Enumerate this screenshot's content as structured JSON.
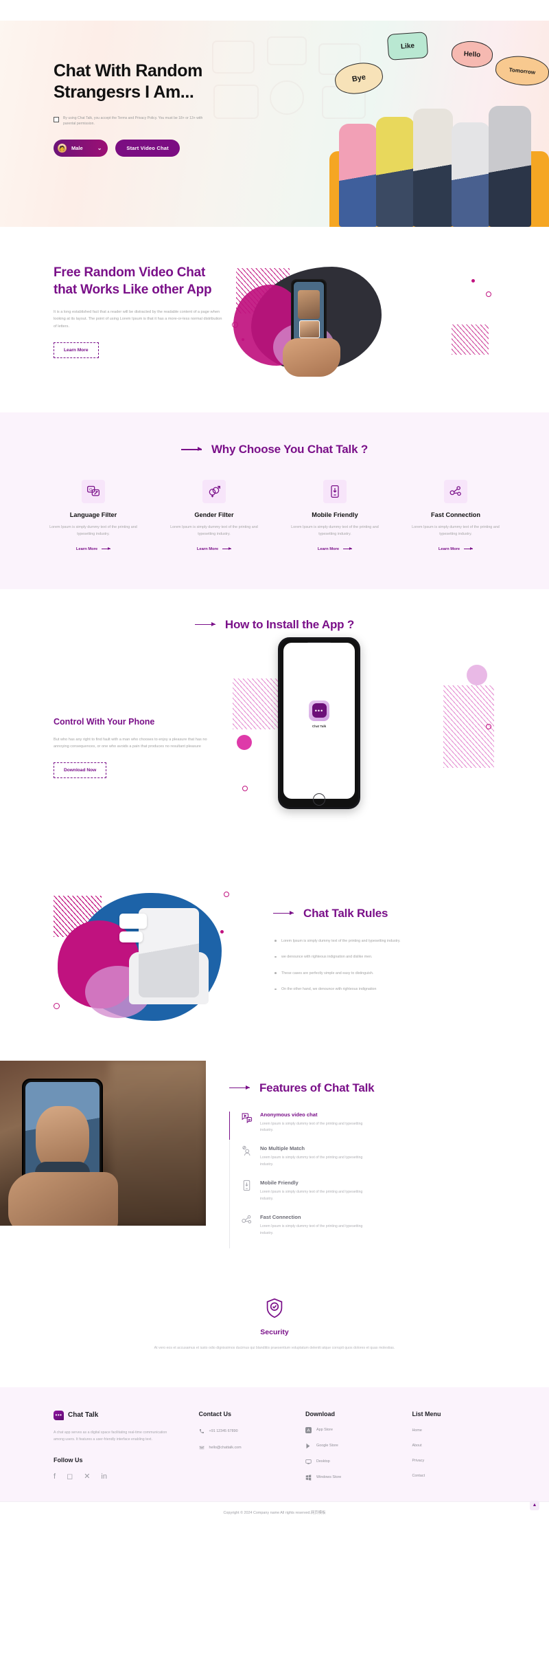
{
  "hero": {
    "title": "Chat With Random Strangesrs I Am...",
    "consent": "By using Chat Talk, you accept the Terms and Privacy Policy. You must be 18+ or 13+ with parental permission.",
    "gender_button": "Male",
    "start_button": "Start Video Chat",
    "bubbles": {
      "bye": "Bye",
      "like": "Like",
      "hello": "Hello",
      "tomorrow": "Tomorrow"
    }
  },
  "free_section": {
    "title": "Free Random Video Chat that Works Like other App",
    "body": "It is a long established fact that a reader will be distracted by the readable content of a page when looking at its layout. The point of using Lorem Ipsum is that it has a more-or-less normal distribution of letters.",
    "button": "Learn More"
  },
  "why": {
    "title": "Why Choose You Chat Talk ?",
    "cards": [
      {
        "name": "Language Filter",
        "desc": "Lorem Ipsum is simply dummy text of the printing and typesetting industry.",
        "link": "Learn More",
        "icon": "translate-icon"
      },
      {
        "name": "Gender Filter",
        "desc": "Lorem Ipsum is simply dummy text of the printing and typesetting industry.",
        "link": "Learn More",
        "icon": "gender-icon"
      },
      {
        "name": "Mobile Friendly",
        "desc": "Lorem Ipsum is simply dummy text of the printing and typesetting industry.",
        "link": "Learn More",
        "icon": "mobile-icon"
      },
      {
        "name": "Fast Connection",
        "desc": "Lorem Ipsum is simply dummy text of the printing and typesetting industry.",
        "link": "Learn More",
        "icon": "network-icon"
      }
    ]
  },
  "install": {
    "title": "How to Install the App ?",
    "heading": "Control With Your Phone",
    "body": "But who has any right to find fault with a man who chooses to enjoy a pleasure that has no annoying consequences, or one who avoids a pain that produces no resultant pleasure",
    "button": "Download Now",
    "app_label": "Chat Talk"
  },
  "rules": {
    "title": "Chat Talk Rules",
    "items": [
      "Lorem Ipsum is simply dummy text of the printing and typesetting industry.",
      "we denounce with righteous indignation and dislike men.",
      "These cases are perfectly simple and easy to distinguish.",
      "On the other hand, we denounce with righteous indignation"
    ]
  },
  "features": {
    "title": "Features of Chat Talk",
    "items": [
      {
        "name": "Anonymous video chat",
        "desc": "Lorem Ipsum is simply dummy text of the printing and typesetting industry.",
        "icon": "video-chat-icon",
        "active": true
      },
      {
        "name": "No Multiple Match",
        "desc": "Lorem Ipsum is simply dummy text of the printing and typesetting industry.",
        "icon": "no-match-icon",
        "active": false
      },
      {
        "name": "Mobile Friendly",
        "desc": "Lorem Ipsum is simply dummy text of the printing and typesetting industry.",
        "icon": "mobile-check-icon",
        "active": false
      },
      {
        "name": "Fast Connection",
        "desc": "Lorem Ipsum is simply dummy text of the printing and typesetting industry.",
        "icon": "network-icon",
        "active": false
      }
    ]
  },
  "security": {
    "title": "Security",
    "body": "At vero eos et accusamus et iusto odio dignissimos ducimus qui blanditiis praesentium voluptatum deleniti atque corrupti quos dolores et quas molestias.",
    "icon": "shield-check-icon"
  },
  "footer": {
    "brand": "Chat Talk",
    "about": "A chat app serves as a digital space facilitating real-time communication among users. It features a user-friendly interface enabling text.",
    "follow_heading": "Follow Us",
    "socials": [
      "facebook-icon",
      "instagram-icon",
      "x-twitter-icon",
      "linkedin-icon"
    ],
    "contact": {
      "heading": "Contact Us",
      "phone": "+91 12345 67890",
      "email": "hello@chattalk.com"
    },
    "download": {
      "heading": "Download",
      "items": [
        "App Store",
        "Google Store",
        "Desktop",
        "Windows Store"
      ]
    },
    "menu": {
      "heading": "List Menu",
      "items": [
        "Home",
        "About",
        "Privacy",
        "Contact"
      ]
    },
    "copyright": "Copyright © 2024 Company name All rights reserved.网页模板",
    "to_top": "▲"
  },
  "colors": {
    "brand_purple": "#7a1089",
    "magenta": "#c0127f",
    "lilac_bg": "#fbf3fc"
  }
}
